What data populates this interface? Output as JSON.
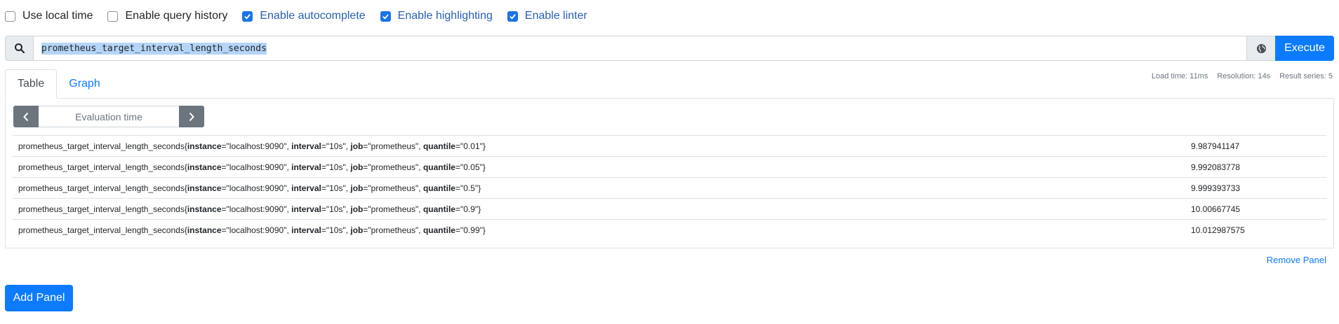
{
  "options": [
    {
      "label": "Use local time",
      "checked": false
    },
    {
      "label": "Enable query history",
      "checked": false
    },
    {
      "label": "Enable autocomplete",
      "checked": true
    },
    {
      "label": "Enable highlighting",
      "checked": true
    },
    {
      "label": "Enable linter",
      "checked": true
    }
  ],
  "expression": {
    "value": "prometheus_target_interval_length_seconds",
    "execute_label": "Execute"
  },
  "tabs": {
    "table": "Table",
    "graph": "Graph",
    "active": "Table"
  },
  "stats": {
    "load_time": "Load time: 11ms",
    "resolution": "Resolution: 14s",
    "result_series": "Result series: 5"
  },
  "evaluation": {
    "placeholder": "Evaluation time"
  },
  "results": [
    {
      "metric": "prometheus_target_interval_length_seconds",
      "labels": [
        {
          "name": "instance",
          "value": "\"localhost:9090\""
        },
        {
          "name": "interval",
          "value": "\"10s\""
        },
        {
          "name": "job",
          "value": "\"prometheus\""
        },
        {
          "name": "quantile",
          "value": "\"0.01\""
        }
      ],
      "value": "9.987941147"
    },
    {
      "metric": "prometheus_target_interval_length_seconds",
      "labels": [
        {
          "name": "instance",
          "value": "\"localhost:9090\""
        },
        {
          "name": "interval",
          "value": "\"10s\""
        },
        {
          "name": "job",
          "value": "\"prometheus\""
        },
        {
          "name": "quantile",
          "value": "\"0.05\""
        }
      ],
      "value": "9.992083778"
    },
    {
      "metric": "prometheus_target_interval_length_seconds",
      "labels": [
        {
          "name": "instance",
          "value": "\"localhost:9090\""
        },
        {
          "name": "interval",
          "value": "\"10s\""
        },
        {
          "name": "job",
          "value": "\"prometheus\""
        },
        {
          "name": "quantile",
          "value": "\"0.5\""
        }
      ],
      "value": "9.999393733"
    },
    {
      "metric": "prometheus_target_interval_length_seconds",
      "labels": [
        {
          "name": "instance",
          "value": "\"localhost:9090\""
        },
        {
          "name": "interval",
          "value": "\"10s\""
        },
        {
          "name": "job",
          "value": "\"prometheus\""
        },
        {
          "name": "quantile",
          "value": "\"0.9\""
        }
      ],
      "value": "10.00667745"
    },
    {
      "metric": "prometheus_target_interval_length_seconds",
      "labels": [
        {
          "name": "instance",
          "value": "\"localhost:9090\""
        },
        {
          "name": "interval",
          "value": "\"10s\""
        },
        {
          "name": "job",
          "value": "\"prometheus\""
        },
        {
          "name": "quantile",
          "value": "\"0.99\""
        }
      ],
      "value": "10.012987575"
    }
  ],
  "panel_actions": {
    "remove_panel": "Remove Panel",
    "add_panel": "Add Panel"
  },
  "colors": {
    "primary": "#0d7bff",
    "checkbox_on": "#1a73e8",
    "secondary": "#6c757d",
    "selection": "#b5d5f7"
  }
}
